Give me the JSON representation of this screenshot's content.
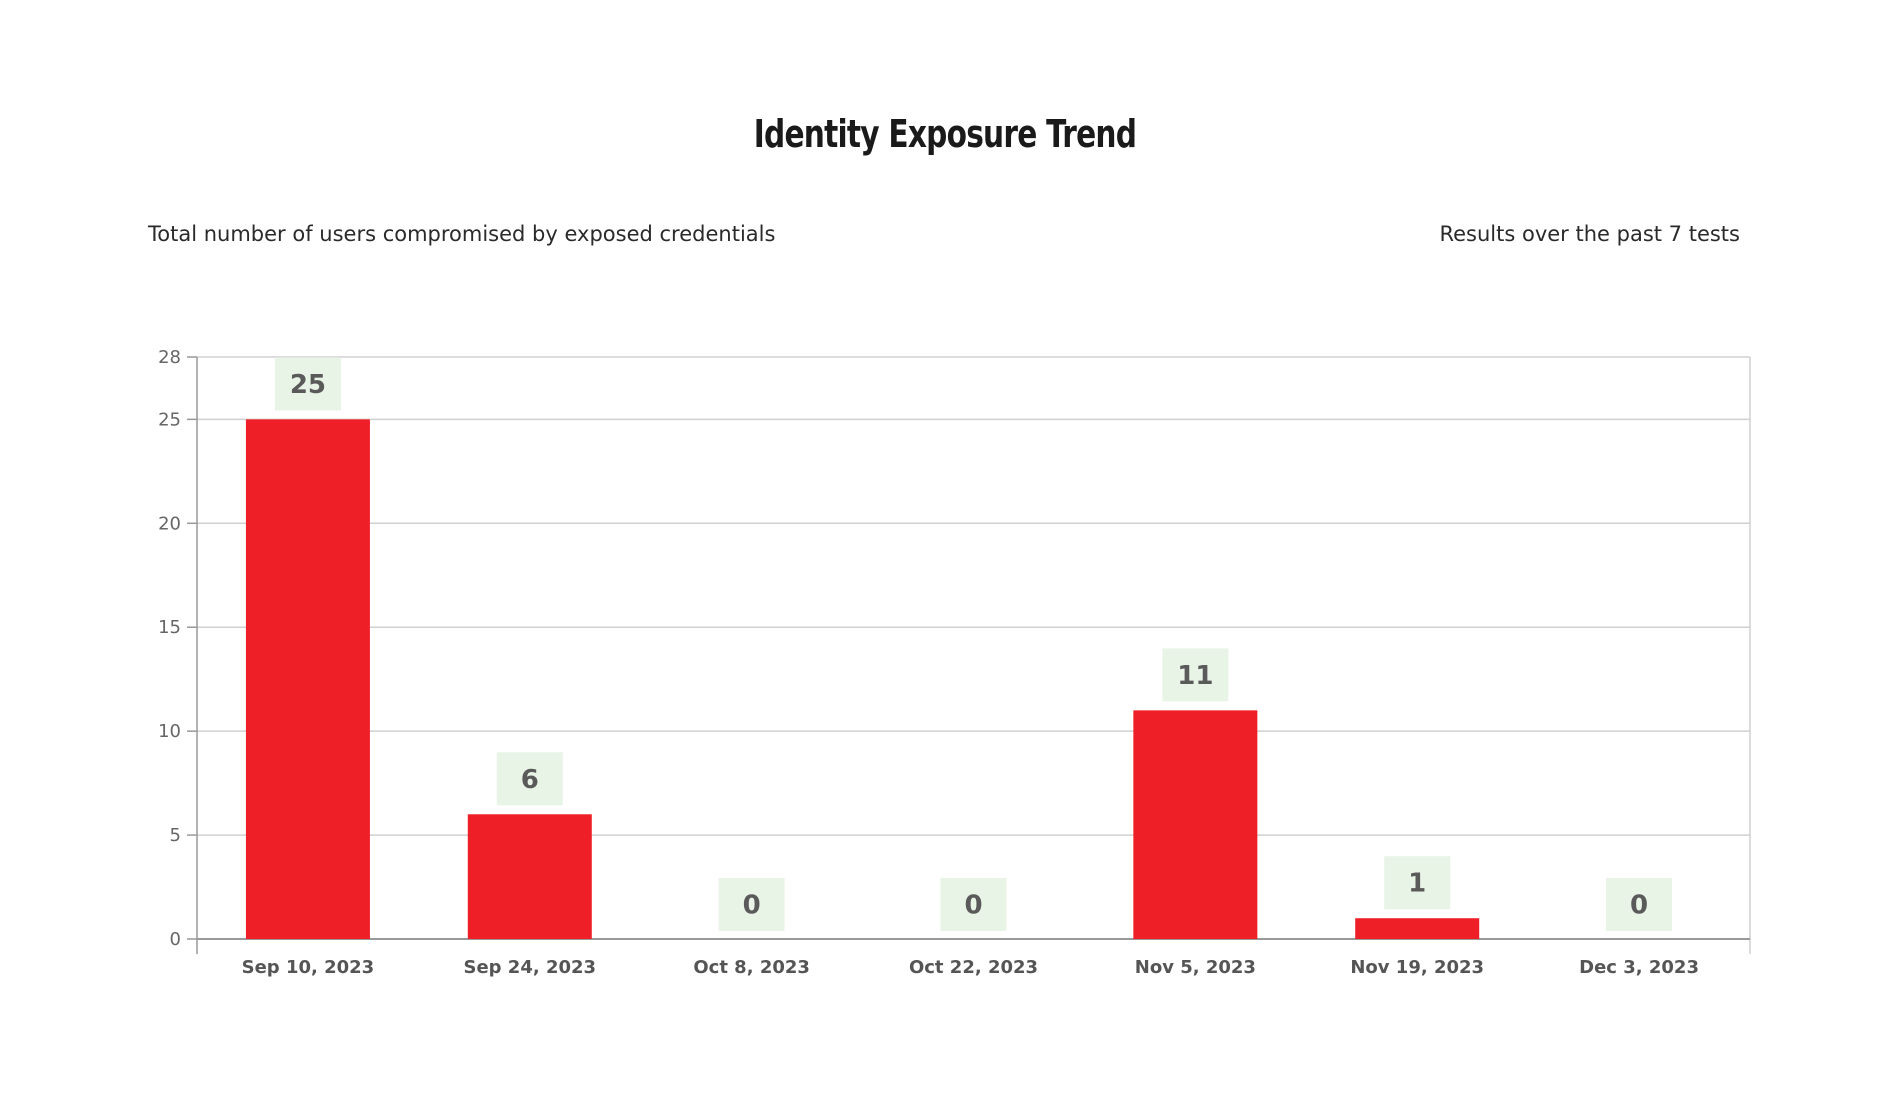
{
  "header": {
    "title": "Identity Exposure Trend",
    "subtitle_left": "Total number of users compromised by exposed credentials",
    "subtitle_right": "Results over the past 7 tests"
  },
  "colors": {
    "bar": "#ee1f27",
    "label_bg": "#e8f4e6",
    "grid": "#d0d0d0",
    "axis": "#999999"
  },
  "chart_data": {
    "type": "bar",
    "categories": [
      "Sep 10, 2023",
      "Sep 24, 2023",
      "Oct 8, 2023",
      "Oct 22, 2023",
      "Nov 5, 2023",
      "Nov 19, 2023",
      "Dec 3, 2023"
    ],
    "values": [
      25,
      6,
      0,
      0,
      11,
      1,
      0
    ],
    "ylim": [
      0,
      28
    ],
    "yticks": [
      0,
      5,
      10,
      15,
      20,
      25,
      28
    ],
    "grid": true,
    "data_labels": true
  }
}
